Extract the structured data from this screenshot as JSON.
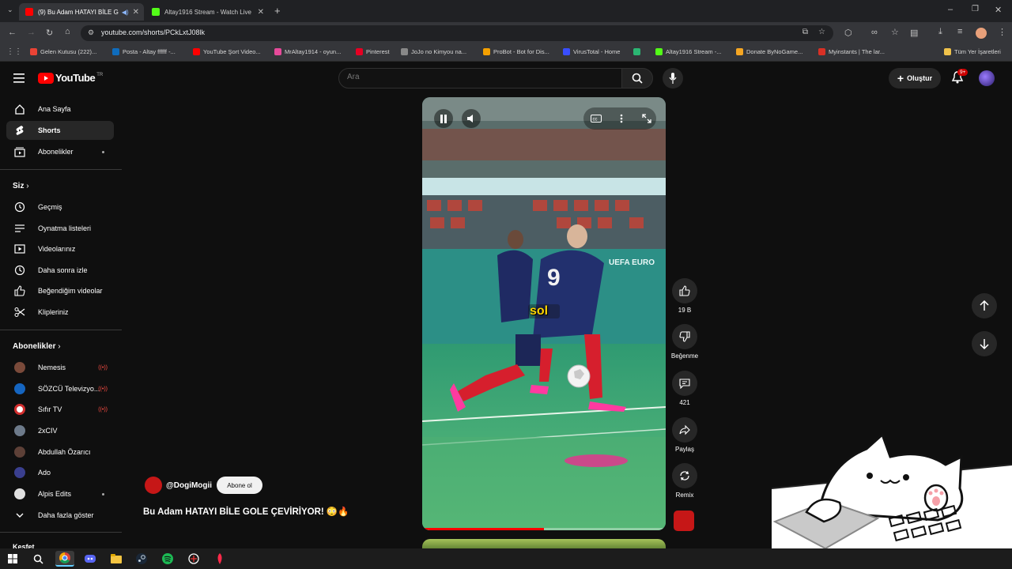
{
  "browser": {
    "tabs": [
      {
        "title": "(9) Bu Adam HATAYI BİLE G",
        "active": true
      },
      {
        "title": "Altay1916 Stream - Watch Live",
        "active": false
      }
    ],
    "url": "youtube.com/shorts/PCkLxtJ08lk",
    "bookmarks": [
      {
        "label": "Gelen Kutusu (222)...",
        "color": "#ea4335"
      },
      {
        "label": "Posta - Altay ffffff -...",
        "color": "#0f6cbd"
      },
      {
        "label": "YouTube Şort Video...",
        "color": "#ff0000"
      },
      {
        "label": "MrAltay1914 - oyun...",
        "color": "#e64a9a"
      },
      {
        "label": "Pinterest",
        "color": "#e60023"
      },
      {
        "label": "JoJo no Kimyou na...",
        "color": "#888888"
      },
      {
        "label": "ProBot - Bot for Dis...",
        "color": "#f4a000"
      },
      {
        "label": "VirusTotal - Home",
        "color": "#394eff"
      },
      {
        "label": "",
        "color": "#2bb673"
      },
      {
        "label": "Altay1916 Stream -...",
        "color": "#53fc18"
      },
      {
        "label": "Donate ByNoGame...",
        "color": "#f5a623"
      },
      {
        "label": "Myinstants | The lar...",
        "color": "#d93025"
      },
      {
        "label": "Tüm Yer İşaretleri",
        "color": "#f0c24b"
      }
    ]
  },
  "header": {
    "logo_text": "YouTube",
    "logo_region": "TR",
    "search_placeholder": "Ara",
    "create_label": "Oluştur",
    "notif_badge": "9+"
  },
  "sidebar": {
    "main": [
      {
        "label": "Ana Sayfa",
        "icon": "home-icon"
      },
      {
        "label": "Shorts",
        "icon": "shorts-icon",
        "active": true
      },
      {
        "label": "Abonelikler",
        "icon": "subscriptions-icon"
      }
    ],
    "you_heading": "Siz",
    "you": [
      {
        "label": "Geçmiş",
        "icon": "history-icon"
      },
      {
        "label": "Oynatma listeleri",
        "icon": "playlist-icon"
      },
      {
        "label": "Videolarınız",
        "icon": "your-videos-icon"
      },
      {
        "label": "Daha sonra izle",
        "icon": "clock-icon"
      },
      {
        "label": "Beğendiğim videolar",
        "icon": "like-icon"
      },
      {
        "label": "Klipleriniz",
        "icon": "scissors-icon"
      }
    ],
    "subs_heading": "Abonelikler",
    "subs": [
      {
        "label": "Nemesis",
        "color": "#7a4a3a",
        "live": true
      },
      {
        "label": "SÖZCÜ Televizyo...",
        "color": "#1565c0",
        "live": true
      },
      {
        "label": "Sıfır TV",
        "color": "#d32f2f",
        "live": true
      },
      {
        "label": "2xCIV",
        "color": "#6d7a8a"
      },
      {
        "label": "Abdullah Özarıcı",
        "color": "#5d4037"
      },
      {
        "label": "Ado",
        "color": "#3a3f8f"
      },
      {
        "label": "Alpis Edits",
        "color": "#e0e0e0",
        "dot": true
      }
    ],
    "more_label": "Daha fazla göster",
    "explore_heading": "Keşfet"
  },
  "short": {
    "channel": "@DogiMogii",
    "subscribe_label": "Abone ol",
    "title": "Bu Adam HATAYI BİLE GOLE ÇEVİRİYOR! 😳🔥",
    "caption": "sol",
    "progress": 0.5,
    "likes": "19 B",
    "dislike_label": "Beğenme",
    "comments": "421",
    "share_label": "Paylaş",
    "remix_label": "Remix",
    "banner": "UEFA EURO"
  }
}
